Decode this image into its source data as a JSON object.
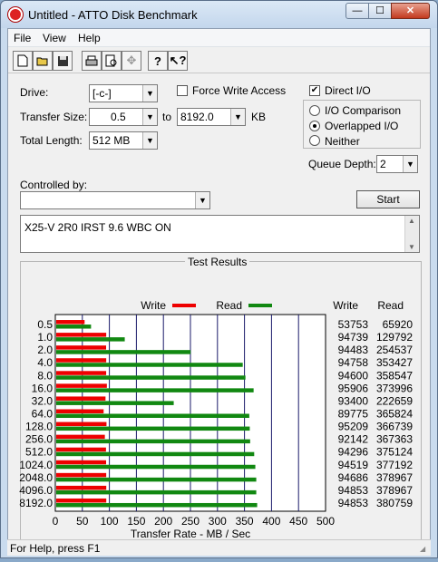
{
  "window": {
    "title": "Untitled - ATTO Disk Benchmark",
    "minimize_glyph": "—",
    "maximize_glyph": "☐",
    "close_glyph": "✕"
  },
  "menu": [
    "File",
    "View",
    "Help"
  ],
  "toolbar_icons": [
    "new-icon",
    "open-icon",
    "save-icon",
    "print-icon",
    "print-preview-icon",
    "move-icon",
    "help-icon",
    "context-help-icon"
  ],
  "form": {
    "drive_label": "Drive:",
    "drive_value": "[-c-]",
    "force_write_label": "Force Write Access",
    "force_write_checked": false,
    "direct_io_label": "Direct I/O",
    "direct_io_checked": true,
    "transfer_size_label": "Transfer Size:",
    "transfer_from": "0.5",
    "to_label": "to",
    "transfer_to": "8192.0",
    "kb_label": "KB",
    "total_length_label": "Total Length:",
    "total_length_value": "512 MB",
    "io_options": [
      "I/O Comparison",
      "Overlapped I/O",
      "Neither"
    ],
    "io_selected": "Overlapped I/O",
    "queue_depth_label": "Queue Depth:",
    "queue_depth_value": "2",
    "controlled_by_label": "Controlled by:",
    "controlled_by_value": "",
    "start_label": "Start",
    "description_text": "X25-V 2R0 IRST 9.6 WBC ON"
  },
  "results": {
    "title": "Test Results",
    "write_legend": "Write",
    "read_legend": "Read",
    "col_write": "Write",
    "col_read": "Read"
  },
  "colors": {
    "write": "#ee0000",
    "read": "#118811",
    "grid": "#1a1a6a"
  },
  "chart_data": {
    "type": "bar",
    "orientation": "horizontal",
    "xlabel": "Transfer Rate - MB / Sec",
    "xlim": [
      0,
      500
    ],
    "xticks": [
      0,
      50,
      100,
      150,
      200,
      250,
      300,
      350,
      400,
      450,
      500
    ],
    "categories": [
      "0.5",
      "1.0",
      "2.0",
      "4.0",
      "8.0",
      "16.0",
      "32.0",
      "64.0",
      "128.0",
      "256.0",
      "512.0",
      "1024.0",
      "2048.0",
      "4096.0",
      "8192.0"
    ],
    "series": [
      {
        "name": "Write",
        "values": [
          52.5,
          92.5,
          92.3,
          92.5,
          92.4,
          93.7,
          91.2,
          87.7,
          93.0,
          90.0,
          92.1,
          92.3,
          92.5,
          92.6,
          92.6
        ]
      },
      {
        "name": "Read",
        "values": [
          64.4,
          126.8,
          248.6,
          345.1,
          350.1,
          365.2,
          217.4,
          357.2,
          358.1,
          358.8,
          366.3,
          368.4,
          370.1,
          370.1,
          371.8
        ]
      }
    ],
    "write_labels": [
      "53753",
      "94739",
      "94483",
      "94758",
      "94600",
      "95906",
      "93400",
      "89775",
      "95209",
      "92142",
      "94296",
      "94519",
      "94686",
      "94853",
      "94853"
    ],
    "read_labels": [
      "65920",
      "129792",
      "254537",
      "353427",
      "358547",
      "373996",
      "222659",
      "365824",
      "366739",
      "367363",
      "375124",
      "377192",
      "378967",
      "378967",
      "380759"
    ]
  },
  "status": {
    "text": "For Help, press F1"
  }
}
